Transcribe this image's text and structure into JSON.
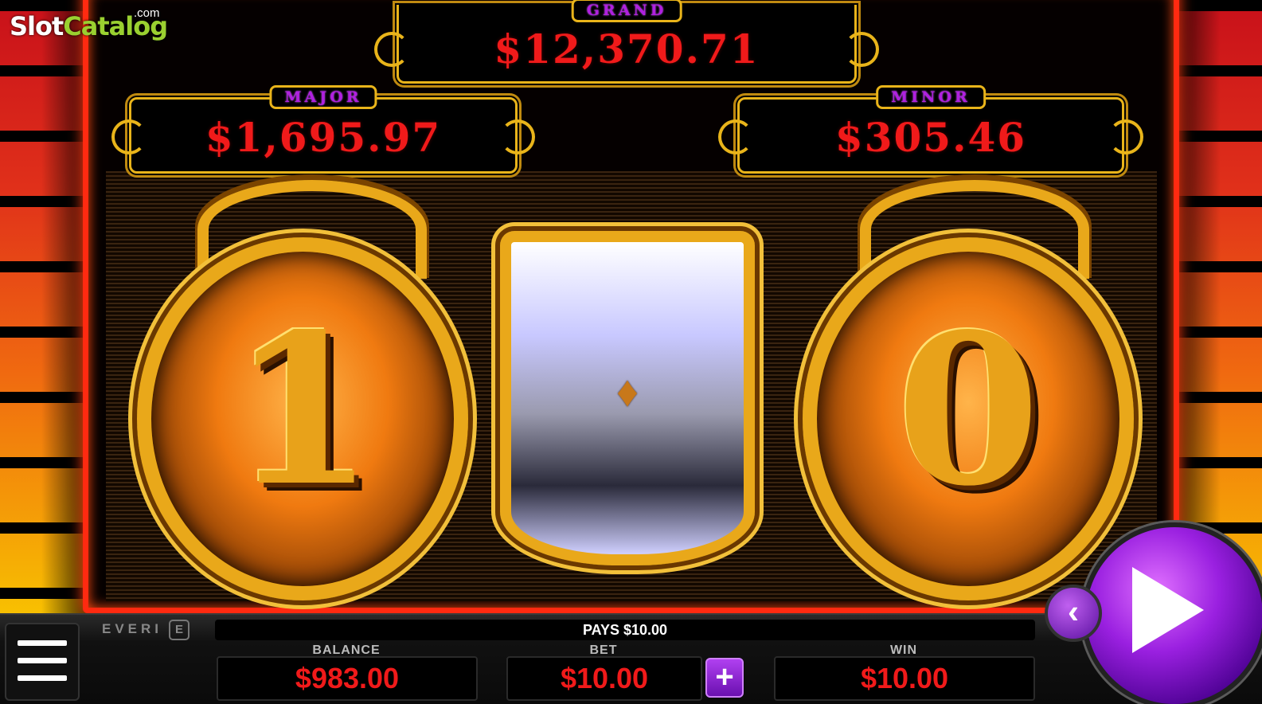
{
  "watermark": {
    "part1": "Slot",
    "part2": "Catalog",
    "suffix": ".com"
  },
  "jackpots": {
    "grand": {
      "label": "GRAND",
      "amount": "$12,370.71"
    },
    "major": {
      "label": "MAJOR",
      "amount": "$1,695.97"
    },
    "minor": {
      "label": "MINOR",
      "amount": "$305.46"
    }
  },
  "reels": {
    "left_digit": "1",
    "right_digit": "0",
    "center_symbol": "fleur-de-lis-icon"
  },
  "footer": {
    "brand": "EVERI",
    "brand_mark": "E",
    "pays": "PAYS $10.00",
    "balance_label": "BALANCE",
    "balance_value": "$983.00",
    "bet_label": "BET",
    "bet_value": "$10.00",
    "bet_plus": "+",
    "win_label": "WIN",
    "win_value": "$10.00"
  },
  "colors": {
    "jackpot_amount": "#f01a1a",
    "jackpot_label": "#b020e0",
    "gold": "#e9b41a",
    "spin": "#9a20e0"
  }
}
